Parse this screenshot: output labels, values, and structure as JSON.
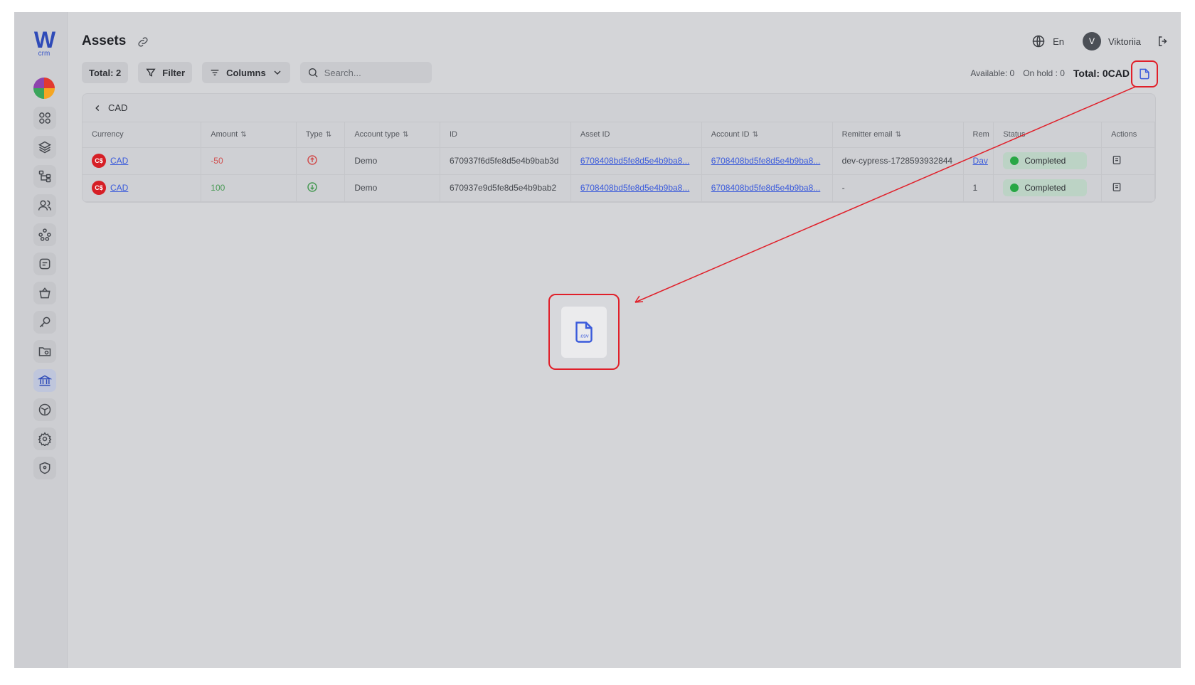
{
  "sidebar": {
    "logo": {
      "letter": "W",
      "sub": "crm"
    },
    "items": [
      {
        "icon": "grid-icon",
        "active": false
      },
      {
        "icon": "layers-icon",
        "active": false
      },
      {
        "icon": "hierarchy-icon",
        "active": false
      },
      {
        "icon": "users-icon",
        "active": false
      },
      {
        "icon": "network-icon",
        "active": false
      },
      {
        "icon": "ticket-icon",
        "active": false
      },
      {
        "icon": "basket-icon",
        "active": false
      },
      {
        "icon": "key-icon",
        "active": false
      },
      {
        "icon": "folder-icon",
        "active": false
      },
      {
        "icon": "bank-icon",
        "active": true
      },
      {
        "icon": "cube-icon",
        "active": false
      },
      {
        "icon": "gear-icon",
        "active": false
      },
      {
        "icon": "shield-icon",
        "active": false
      }
    ]
  },
  "header": {
    "title": "Assets",
    "language": "En",
    "user_initial": "V",
    "user_name": "Viktoriia"
  },
  "toolbar": {
    "total_label": "Total: 2",
    "filter_label": "Filter",
    "columns_label": "Columns",
    "search_placeholder": "Search..."
  },
  "stats": {
    "available": "Available: 0",
    "on_hold": "On hold : 0",
    "total": "Total: 0CAD"
  },
  "table": {
    "group_label": "CAD",
    "columns": [
      "Currency",
      "Amount",
      "Type",
      "Account type",
      "ID",
      "Asset ID",
      "Account ID",
      "Remitter email",
      "Rem",
      "Status",
      "Actions"
    ],
    "rows": [
      {
        "currency_badge": "C$",
        "currency": "CAD",
        "amount": "-50",
        "type": "out",
        "account_type": "Demo",
        "id": "670937f6d5fe8d5e4b9bab3d",
        "asset_id": "6708408bd5fe8d5e4b9ba8...",
        "account_id": "6708408bd5fe8d5e4b9ba8...",
        "remitter_email": "dev-cypress-1728593932844",
        "rem": "Dav",
        "status": "Completed"
      },
      {
        "currency_badge": "C$",
        "currency": "CAD",
        "amount": "100",
        "type": "in",
        "account_type": "Demo",
        "id": "670937e9d5fe8d5e4b9bab2",
        "asset_id": "6708408bd5fe8d5e4b9ba8...",
        "account_id": "6708408bd5fe8d5e4b9ba8...",
        "remitter_email": "-",
        "rem": "1",
        "status": "Completed"
      }
    ]
  },
  "zoom": {
    "icon_text": ".csv"
  },
  "colors": {
    "accent": "#3b5bdb",
    "highlight": "#e0202a",
    "success": "#28a745"
  }
}
